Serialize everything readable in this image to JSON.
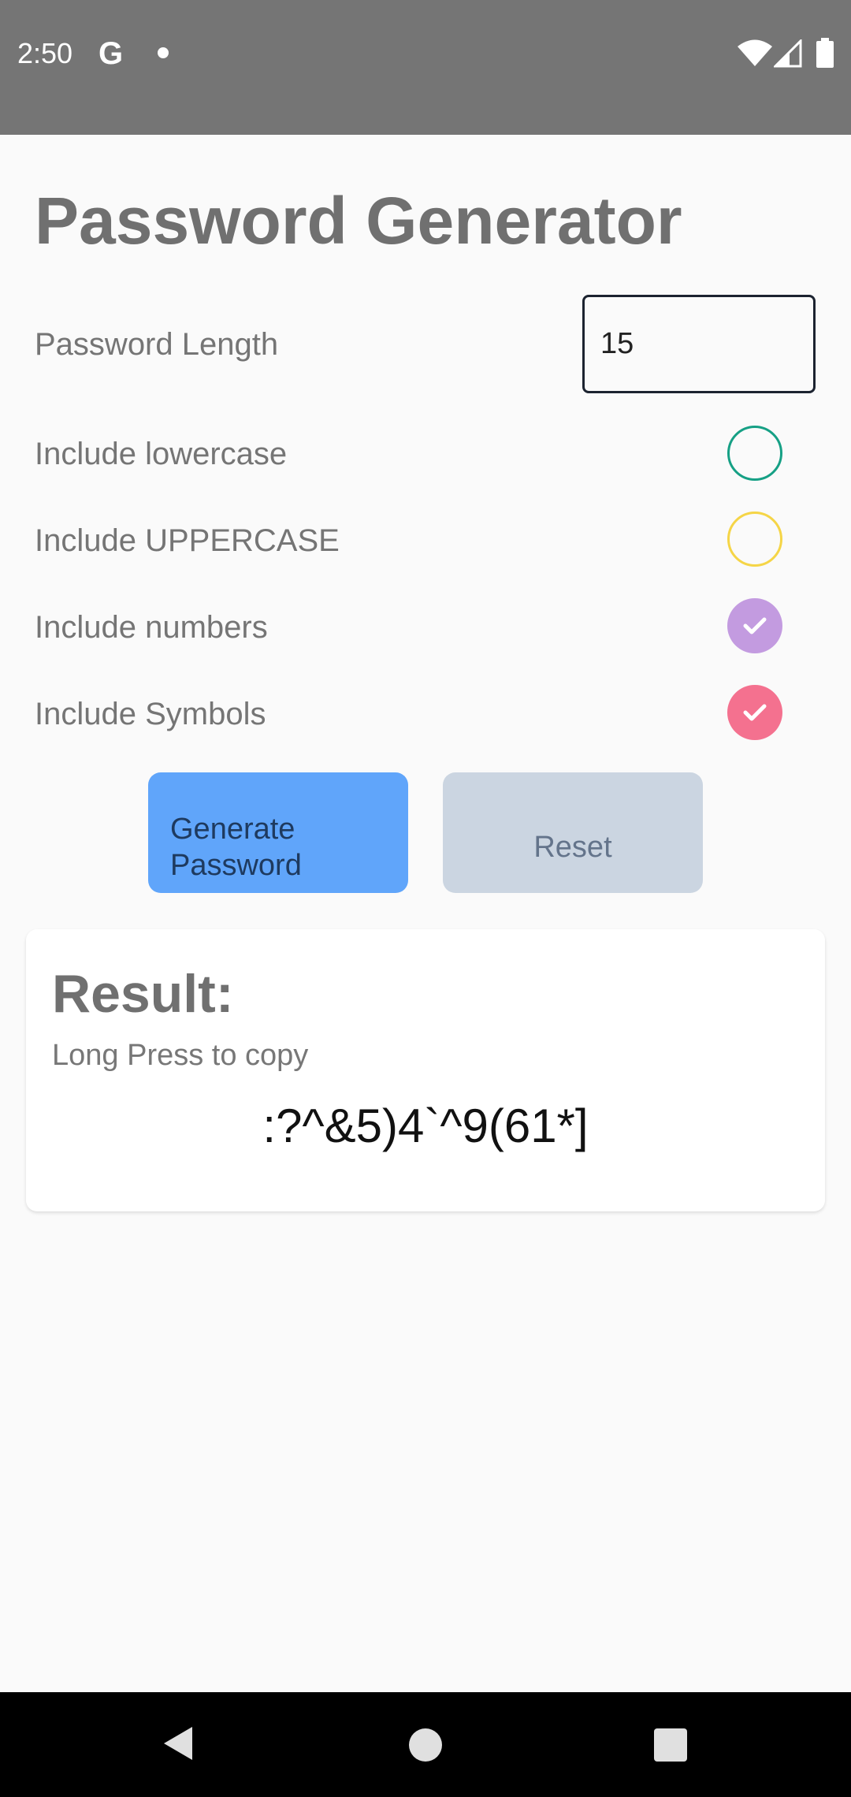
{
  "status_bar": {
    "time": "2:50",
    "google_icon_letter": "G",
    "icons": [
      "google-icon",
      "notification-dot-icon",
      "wifi-icon",
      "signal-icon",
      "battery-icon"
    ]
  },
  "app": {
    "title": "Password Generator"
  },
  "password_length": {
    "label": "Password Length",
    "value": "15"
  },
  "options": [
    {
      "label": "Include lowercase",
      "checked": false,
      "color": "#16a085"
    },
    {
      "label": "Include UPPERCASE",
      "checked": false,
      "color": "#f5d547"
    },
    {
      "label": "Include numbers",
      "checked": true,
      "color": "#c39be0"
    },
    {
      "label": "Include Symbols",
      "checked": true,
      "color": "#f4718f"
    }
  ],
  "buttons": {
    "generate_line1": "Generate",
    "generate_line2": "Password",
    "reset": "Reset"
  },
  "result": {
    "title": "Result:",
    "hint": "Long Press to copy",
    "password": ":?^&5)4`^9(61*]"
  },
  "colors": {
    "status_bar": "#757575",
    "generate_button": "#60a5fa",
    "reset_button": "#cbd5e1",
    "background": "#fafafa"
  },
  "nav_bar": {
    "icons": [
      "back-icon",
      "home-icon",
      "recents-icon"
    ]
  }
}
